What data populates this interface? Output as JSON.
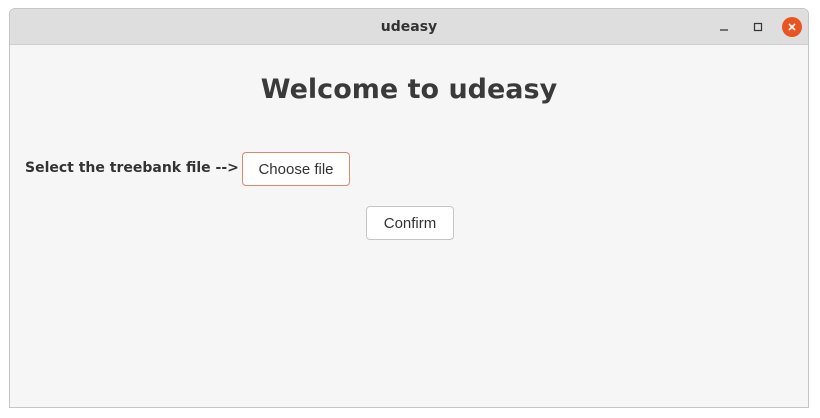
{
  "window": {
    "title": "udeasy",
    "controls": {
      "minimize_icon": "minimize-icon",
      "maximize_icon": "maximize-icon",
      "close_icon": "close-icon",
      "close_color": "#e95420"
    }
  },
  "main": {
    "heading": "Welcome to udeasy",
    "select_label": "Select the treebank file -->",
    "choose_file_label": "Choose file",
    "confirm_label": "Confirm"
  },
  "colors": {
    "accent_border": "#e0866a",
    "background": "#f6f6f6",
    "titlebar": "#dedede"
  }
}
